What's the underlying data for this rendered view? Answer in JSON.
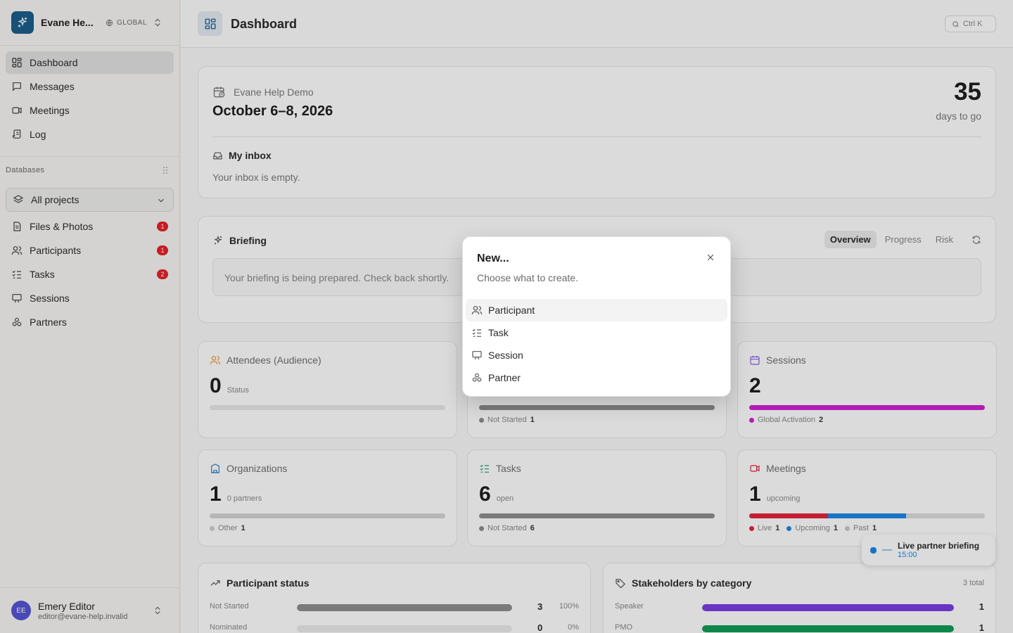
{
  "colors": {
    "brand": "#1b5f8c",
    "badge_red": "#e5242a",
    "avatar": "#5454d6",
    "magenta": "#d021d6",
    "live_red": "#e5243a",
    "upcoming_blue": "#1e88e5",
    "speaker_purple": "#7b3fe4",
    "pmo_green": "#0f9d58"
  },
  "sidebar": {
    "workspace_name": "Evane He...",
    "scope_label": "GLOBAL",
    "nav": [
      {
        "label": "Dashboard",
        "icon": "dashboard-icon",
        "active": true
      },
      {
        "label": "Messages",
        "icon": "message-icon"
      },
      {
        "label": "Meetings",
        "icon": "video-icon"
      },
      {
        "label": "Log",
        "icon": "scroll-icon"
      }
    ],
    "databases_label": "Databases",
    "project_select": "All projects",
    "db_items": [
      {
        "label": "Files & Photos",
        "icon": "file-icon",
        "badge": "1"
      },
      {
        "label": "Participants",
        "icon": "users-icon",
        "badge": "1"
      },
      {
        "label": "Tasks",
        "icon": "checklist-icon",
        "badge": "2"
      },
      {
        "label": "Sessions",
        "icon": "presentation-icon",
        "badge": ""
      },
      {
        "label": "Partners",
        "icon": "handshake-icon",
        "badge": ""
      }
    ],
    "user": {
      "initials": "EE",
      "name": "Emery Editor",
      "email": "editor@evane-help.invalid"
    }
  },
  "topbar": {
    "title": "Dashboard",
    "search_shortcut": "Ctrl K"
  },
  "event": {
    "name": "Evane Help Demo",
    "dates": "October 6–8, 2026",
    "countdown_value": "35",
    "countdown_label": "days to go",
    "inbox_title": "My inbox",
    "inbox_empty": "Your inbox is empty."
  },
  "briefing": {
    "title": "Briefing",
    "tabs": [
      "Overview",
      "Progress",
      "Risk"
    ],
    "message": "Your briefing is being prepared. Check back shortly."
  },
  "stats": {
    "attendees": {
      "title": "Attendees (Audience)",
      "value": "0",
      "unit": "Status"
    },
    "hidden_middle": {
      "legend_label": "Not Started",
      "legend_value": "1"
    },
    "sessions": {
      "title": "Sessions",
      "value": "2",
      "legend_label": "Global Activation",
      "legend_value": "2"
    },
    "organizations": {
      "title": "Organizations",
      "value": "1",
      "unit": "0 partners",
      "legend_label": "Other",
      "legend_value": "1"
    },
    "tasks": {
      "title": "Tasks",
      "value": "6",
      "unit": "open",
      "legend_label": "Not Started",
      "legend_value": "6"
    },
    "meetings": {
      "title": "Meetings",
      "value": "1",
      "unit": "upcoming",
      "legend": [
        {
          "label": "Live",
          "value": "1",
          "color": "#e5243a"
        },
        {
          "label": "Upcoming",
          "value": "1",
          "color": "#1e88e5"
        },
        {
          "label": "Past",
          "value": "1",
          "color": "#c8c8c8"
        }
      ]
    }
  },
  "toast": {
    "title": "Live partner briefing",
    "time": "15:00"
  },
  "participant_status": {
    "title": "Participant status",
    "rows": [
      {
        "label": "Not Started",
        "count": "3",
        "pct": "100%",
        "fraction": 1.0
      },
      {
        "label": "Nominated",
        "count": "0",
        "pct": "0%",
        "fraction": 0.0
      }
    ]
  },
  "stakeholders": {
    "title": "Stakeholders by category",
    "total": "3 total",
    "rows": [
      {
        "label": "Speaker",
        "count": "1",
        "fraction": 1.0,
        "color": "#7b3fe4"
      },
      {
        "label": "PMO",
        "count": "1",
        "fraction": 1.0,
        "color": "#0f9d58"
      }
    ]
  },
  "dialog": {
    "title": "New...",
    "subtitle": "Choose what to create.",
    "items": [
      {
        "label": "Participant",
        "icon": "users-icon"
      },
      {
        "label": "Task",
        "icon": "checklist-icon"
      },
      {
        "label": "Session",
        "icon": "presentation-icon"
      },
      {
        "label": "Partner",
        "icon": "handshake-icon"
      }
    ]
  }
}
